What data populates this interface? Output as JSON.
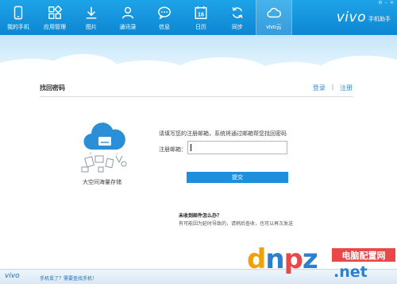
{
  "toolbar": {
    "items": [
      {
        "label": "我的手机",
        "icon": "phone-icon"
      },
      {
        "label": "应用管理",
        "icon": "apps-grid-icon"
      },
      {
        "label": "图片",
        "icon": "download-icon"
      },
      {
        "label": "通讯录",
        "icon": "contact-icon"
      },
      {
        "label": "信息",
        "icon": "message-icon"
      },
      {
        "label": "日历",
        "icon": "calendar-icon"
      },
      {
        "label": "同步",
        "icon": "sync-icon"
      },
      {
        "label": "vivo云",
        "icon": "cloud-icon"
      }
    ],
    "calendar_day": "16",
    "active_item": "vivo云"
  },
  "brand": {
    "logo": "vivo",
    "subtitle": "手机助手"
  },
  "panel": {
    "title": "找回密码",
    "login_link": "登录",
    "separator": "|",
    "register_link": "注册"
  },
  "illustration": {
    "label": "大空间海量存储"
  },
  "form": {
    "instruction": "请填写您的注册邮箱，系统将通过邮箱帮您找回密码",
    "email_label": "注册邮箱：",
    "email_value": "",
    "submit_label": "提交"
  },
  "hint": {
    "title": "未收到邮件怎么办？",
    "text": "有可能因为延时导致的，请稍后查收，也可以再次发送"
  },
  "footer": {
    "logo": "vivo",
    "link": "手机丢了？需要查找手机！"
  },
  "watermark": {
    "part_d": "d",
    "part_n": "n",
    "part_p": "p",
    "part_z": "z",
    "badge": "电脑配置网",
    "domain": ".net"
  },
  "colors": {
    "toolbar": "#1595e0",
    "accent": "#1e8fdc",
    "link": "#2a8fd6"
  }
}
